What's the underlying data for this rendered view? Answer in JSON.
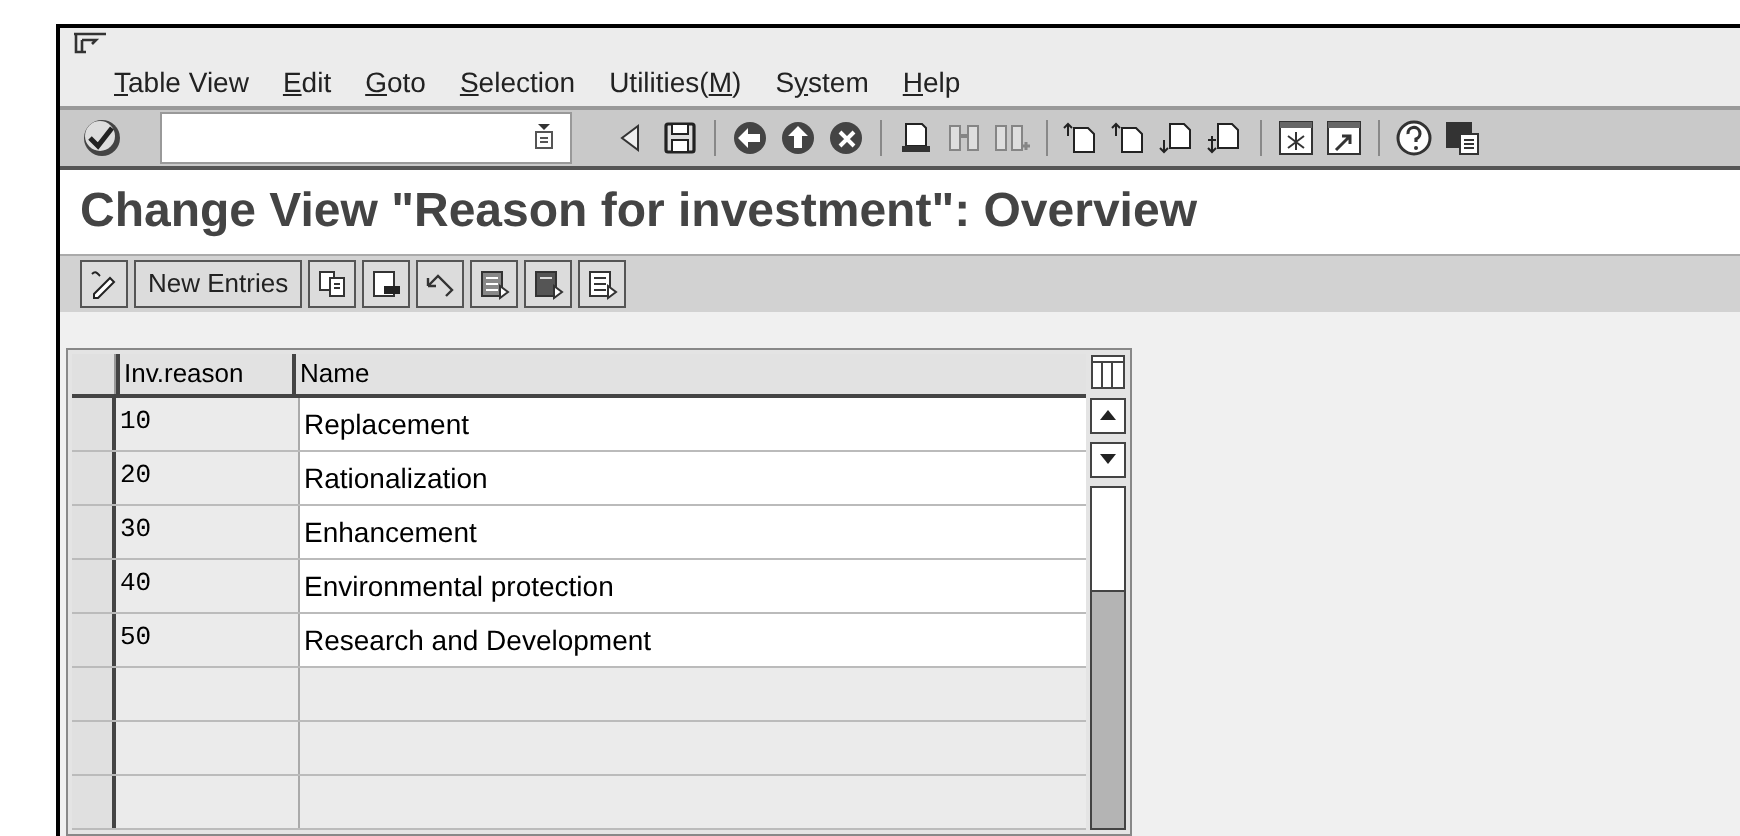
{
  "menu_bar": {
    "items": [
      {
        "parts": [
          {
            "text": "T",
            "underlined": true
          },
          {
            "text": "able View",
            "underlined": false
          }
        ]
      },
      {
        "parts": [
          {
            "text": "E",
            "underlined": true
          },
          {
            "text": "dit",
            "underlined": false
          }
        ]
      },
      {
        "parts": [
          {
            "text": "G",
            "underlined": true
          },
          {
            "text": "oto",
            "underlined": false
          }
        ]
      },
      {
        "parts": [
          {
            "text": "S",
            "underlined": true
          },
          {
            "text": "election",
            "underlined": false
          }
        ]
      },
      {
        "parts": [
          {
            "text": "Utilities(",
            "underlined": false
          },
          {
            "text": "M",
            "underlined": true
          },
          {
            "text": ")",
            "underlined": false
          }
        ]
      },
      {
        "parts": [
          {
            "text": "S",
            "underlined": false
          },
          {
            "text": "y",
            "underlined": true
          },
          {
            "text": "stem",
            "underlined": false
          }
        ]
      },
      {
        "parts": [
          {
            "text": "H",
            "underlined": true
          },
          {
            "text": "elp",
            "underlined": false
          }
        ]
      }
    ]
  },
  "title": "Change View \"Reason for investment\": Overview",
  "app_toolbar": {
    "new_entries_label": "New Entries"
  },
  "table": {
    "columns": [
      "Inv.reason",
      "Name"
    ],
    "rows": [
      {
        "code": "10",
        "name": "Replacement"
      },
      {
        "code": "20",
        "name": "Rationalization"
      },
      {
        "code": "30",
        "name": "Enhancement"
      },
      {
        "code": "40",
        "name": "Environmental protection"
      },
      {
        "code": "50",
        "name": "Research and Development"
      }
    ]
  }
}
